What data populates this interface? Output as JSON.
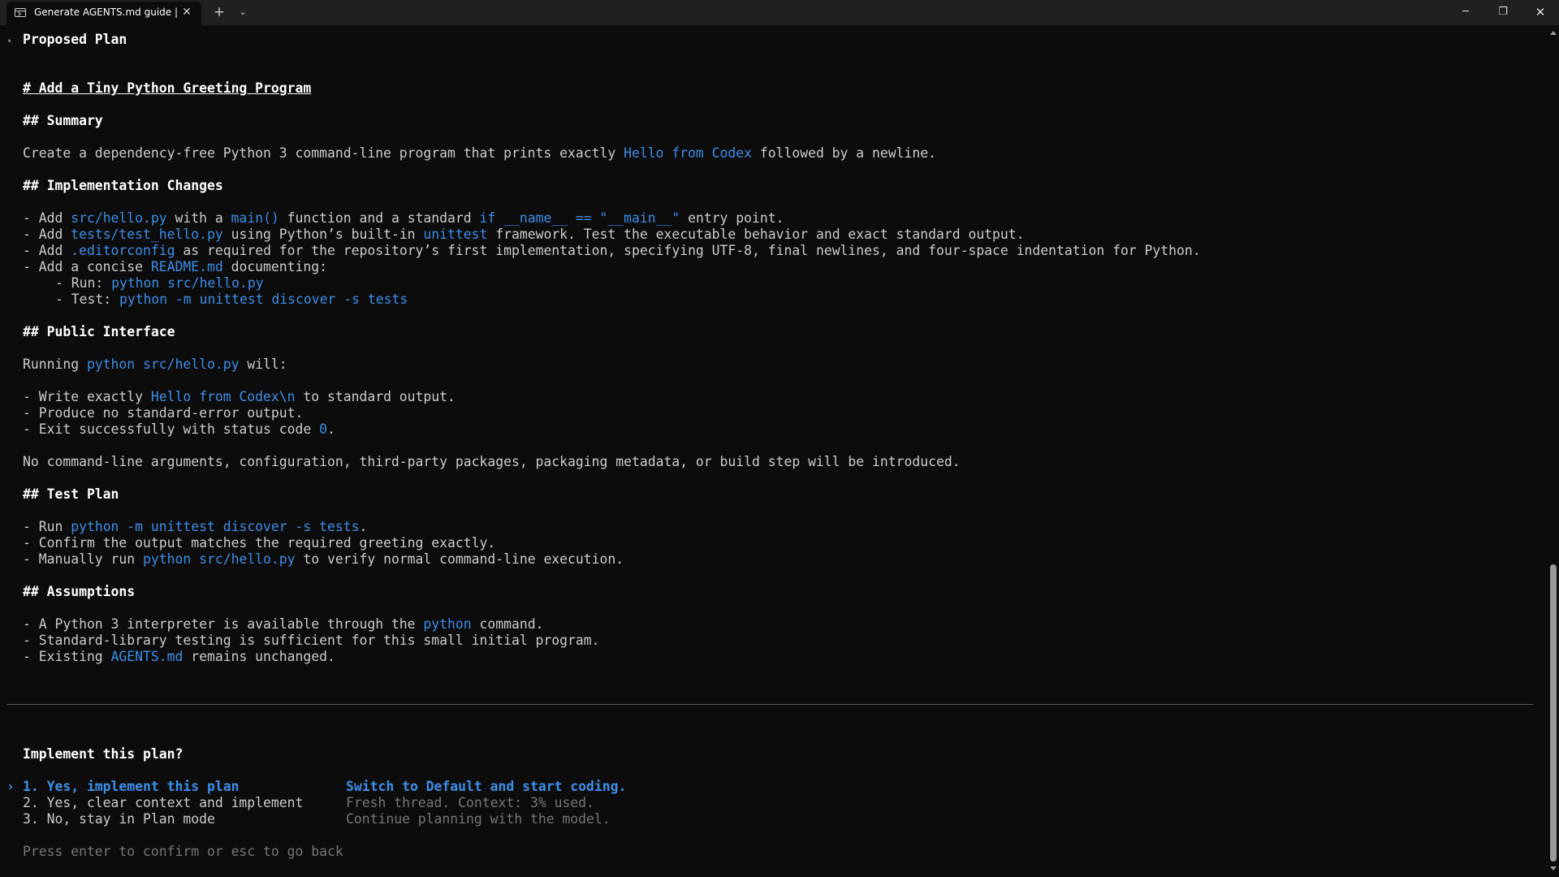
{
  "window": {
    "tab_title": "Generate AGENTS.md guide |",
    "tab_close": "✕",
    "new_tab": "+",
    "tab_dropdown": "⌄",
    "minimize": "─",
    "restore": "❐",
    "close": "✕"
  },
  "terminal": {
    "bullet": "•",
    "heading": "Proposed Plan",
    "plan_title": "# Add a Tiny Python Greeting Program",
    "summary_heading": "## Summary",
    "summary": {
      "pre": "Create a dependency-free Python 3 command-line program that prints exactly ",
      "code": "Hello from Codex",
      "post": " followed by a newline."
    },
    "impl_heading": "## Implementation Changes",
    "impl": {
      "l1_a": "- Add ",
      "l1_code1": "src/hello.py",
      "l1_b": " with a ",
      "l1_code2": "main()",
      "l1_c": " function and a standard ",
      "l1_code3": "if __name__ == \"__main__\"",
      "l1_d": " entry point.",
      "l2_a": "- Add ",
      "l2_code1": "tests/test_hello.py",
      "l2_b": " using Python’s built-in ",
      "l2_code2": "unittest",
      "l2_c": " framework. Test the executable behavior and exact standard output.",
      "l3_a": "- Add ",
      "l3_code1": ".editorconfig",
      "l3_b": " as required for the repository’s first implementation, specifying UTF-8, final newlines, and four-space indentation for Python.",
      "l4_a": "- Add a concise ",
      "l4_code1": "README.md",
      "l4_b": " documenting:",
      "l5_a": "- Run: ",
      "l5_code1": "python src/hello.py",
      "l6_a": "- Test: ",
      "l6_code1": "python -m unittest discover -s tests"
    },
    "public_heading": "## Public Interface",
    "public": {
      "running_a": "Running ",
      "running_code": "python src/hello.py",
      "running_b": " will:",
      "w1_a": "- Write exactly ",
      "w1_code": "Hello from Codex\\n",
      "w1_b": " to standard output.",
      "w2": "- Produce no standard-error output.",
      "w3_a": "- Exit successfully with status code ",
      "w3_code": "0",
      "w3_b": ".",
      "note": "No command-line arguments, configuration, third-party packages, packaging metadata, or build step will be introduced."
    },
    "test_heading": "## Test Plan",
    "test": {
      "t1_a": "- Run ",
      "t1_code": "python -m unittest discover -s tests",
      "t1_b": ".",
      "t2": "- Confirm the output matches the required greeting exactly.",
      "t3_a": "- Manually run ",
      "t3_code": "python src/hello.py",
      "t3_b": " to verify normal command-line execution."
    },
    "assumptions_heading": "## Assumptions",
    "assumptions": {
      "a1_a": "- A Python 3 interpreter is available through the ",
      "a1_code": "python",
      "a1_b": " command.",
      "a2": "- Standard-library testing is sufficient for this small initial program.",
      "a3_a": "- Existing ",
      "a3_code": "AGENTS.md",
      "a3_b": " remains unchanged."
    },
    "prompt": {
      "question": "Implement this plan?",
      "selected_marker": "›",
      "options": [
        {
          "label": "1. Yes, implement this plan",
          "desc": "Switch to Default and start coding."
        },
        {
          "label": "2. Yes, clear context and implement",
          "desc": "Fresh thread. Context: 3% used."
        },
        {
          "label": "3. No, stay in Plan mode",
          "desc": "Continue planning with the model."
        }
      ],
      "hint": "Press enter to confirm or esc to go back"
    }
  },
  "colors": {
    "background": "#0c0c0c",
    "titlebar": "#202020",
    "text": "#cccccc",
    "accent": "#3b8eea",
    "dim": "#767676"
  }
}
